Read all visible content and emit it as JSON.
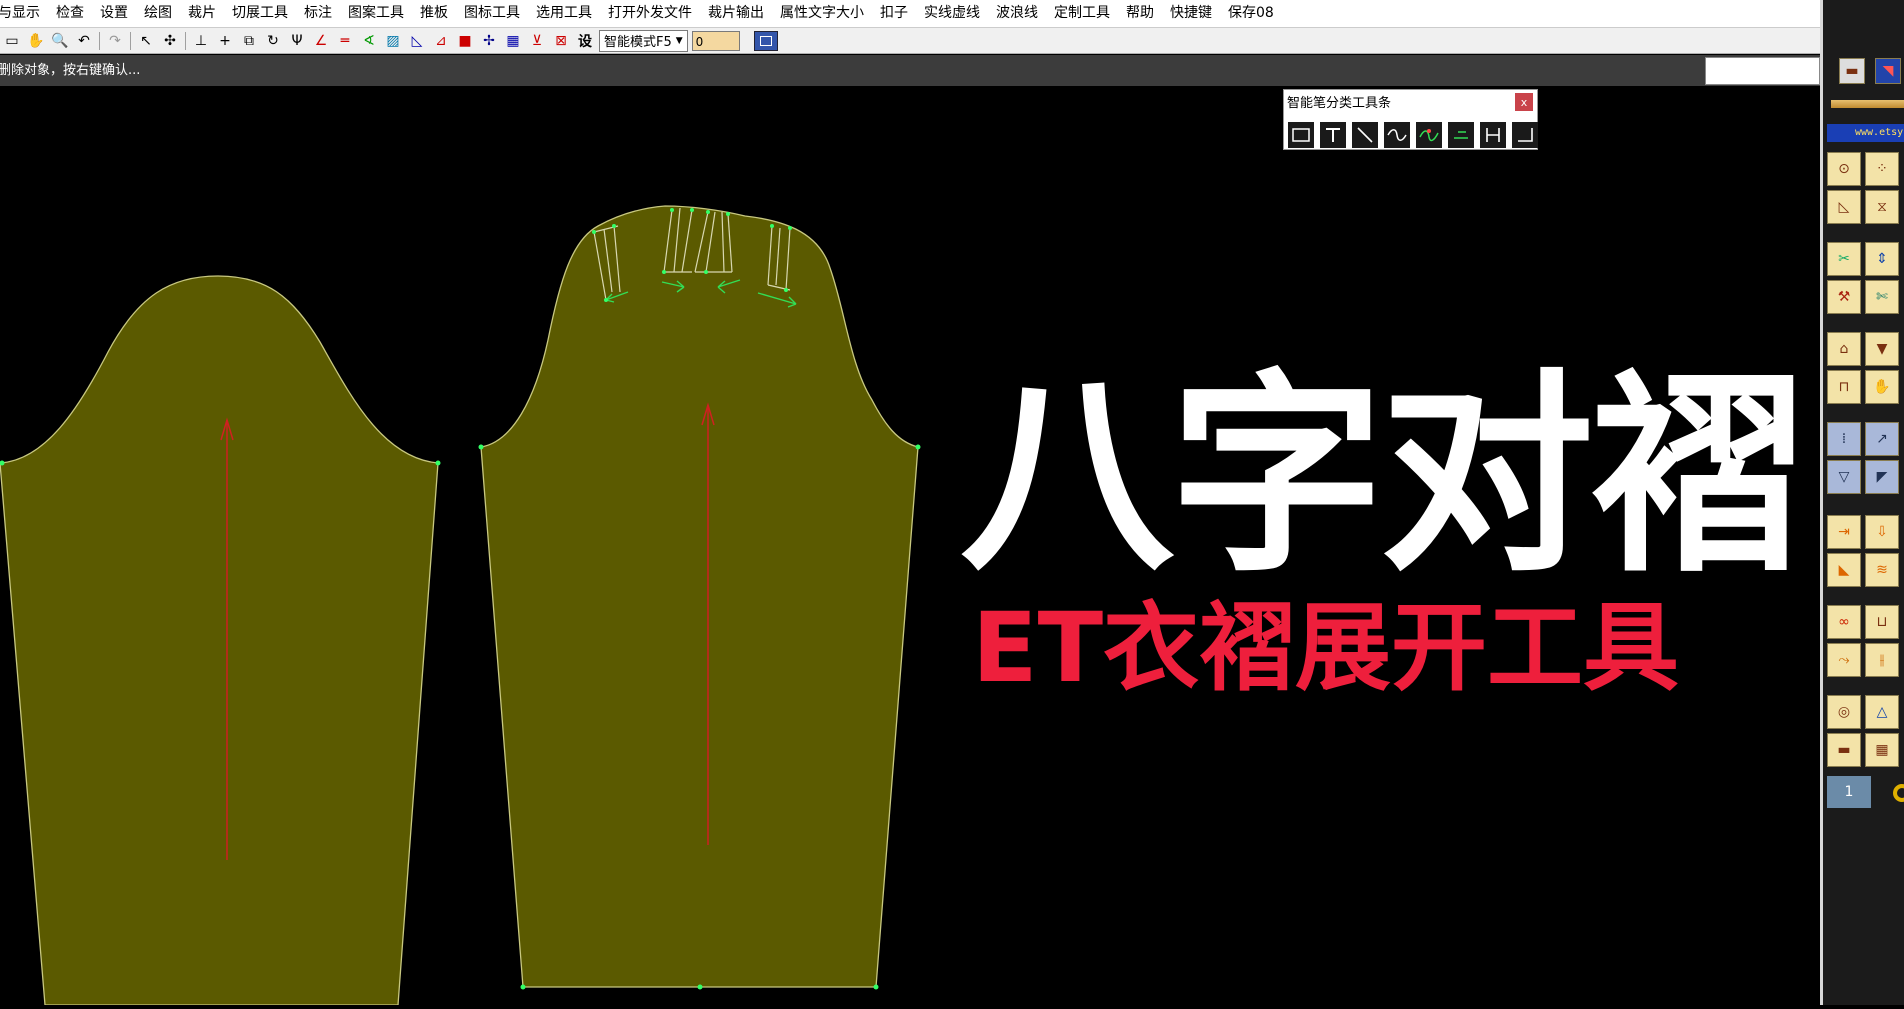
{
  "menu": [
    "与显示",
    "检查",
    "设置",
    "绘图",
    "裁片",
    "切展工具",
    "标注",
    "图案工具",
    "推板",
    "图标工具",
    "选用工具",
    "打开外发文件",
    "裁片输出",
    "属性文字大小",
    "扣子",
    "实线虚线",
    "波浪线",
    "定制工具",
    "帮助",
    "快捷键",
    "保存08"
  ],
  "toolbar": {
    "settings_label": "设",
    "mode_select": "智能模式F5",
    "num_value": "0"
  },
  "status": {
    "prompt": "删除对象，按右键确认..."
  },
  "floating_toolbar": {
    "title": "智能笔分类工具条",
    "close": "x"
  },
  "right_panel": {
    "url_text": "www.etsy",
    "page_tab": "1"
  },
  "overlay": {
    "title": "八字对褶",
    "subtitle": "ET衣褶展开工具"
  },
  "colors": {
    "pattern_fill": "#5b5a00",
    "title": "#ffffff",
    "subtitle": "#ee1f3c",
    "grainline": "#d02020",
    "point_marker": "#33ff66"
  }
}
